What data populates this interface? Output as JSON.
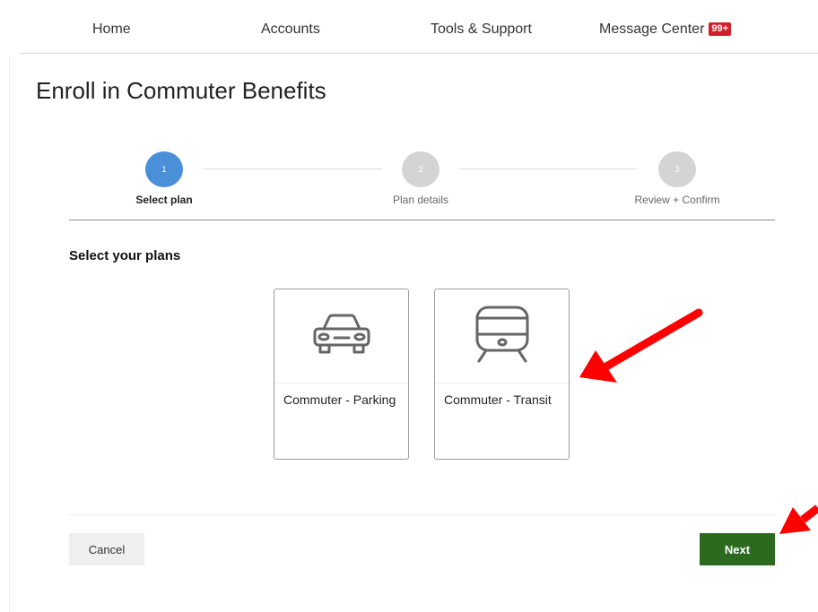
{
  "nav": {
    "items": [
      {
        "label": "Home"
      },
      {
        "label": "Accounts"
      },
      {
        "label": "Tools & Support"
      },
      {
        "label": "Message Center",
        "badge": "99+"
      }
    ]
  },
  "page": {
    "title": "Enroll in Commuter Benefits"
  },
  "stepper": {
    "steps": [
      {
        "number": "1",
        "label": "Select plan",
        "state": "active"
      },
      {
        "number": "2",
        "label": "Plan details",
        "state": "inactive"
      },
      {
        "number": "3",
        "label": "Review + Confirm",
        "state": "inactive"
      }
    ]
  },
  "plans": {
    "heading": "Select your plans",
    "cards": [
      {
        "icon": "car-icon",
        "label": "Commuter - Parking"
      },
      {
        "icon": "train-icon",
        "label": "Commuter - Transit"
      }
    ]
  },
  "actions": {
    "cancel_label": "Cancel",
    "next_label": "Next"
  },
  "colors": {
    "step_active": "#4a90d9",
    "step_inactive": "#d4d4d4",
    "primary_button": "#2b6a1f",
    "badge": "#d71e28",
    "annotation_arrow": "#ff0000"
  }
}
